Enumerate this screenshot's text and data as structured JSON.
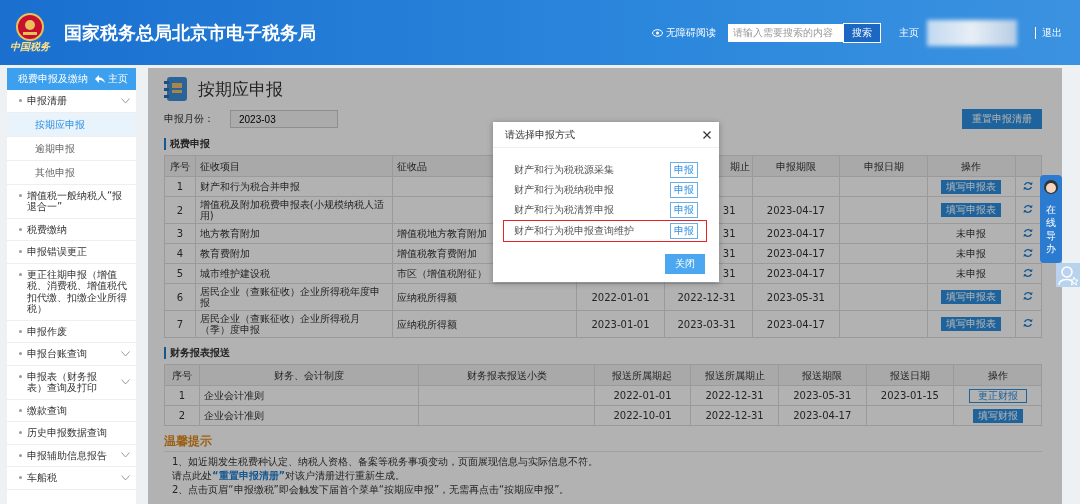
{
  "header": {
    "site_title": "国家税务总局北京市电子税务局",
    "logo_caption": "中国税务",
    "accessibility_label": "无障碍阅读",
    "search": {
      "placeholder": "请输入需要搜索的内容",
      "button": "搜索"
    },
    "home_link": "主页",
    "logout_link": "退出"
  },
  "sidebar": {
    "title": "税费申报及缴纳",
    "home": "主页",
    "items": [
      {
        "label": "申报清册",
        "kind": "group",
        "children": [
          {
            "label": "按期应申报",
            "selected": true
          },
          {
            "label": "逾期申报",
            "selected": false
          },
          {
            "label": "其他申报",
            "selected": false
          }
        ]
      },
      {
        "label": "增值税一般纳税人“报退合一”",
        "kind": "link"
      },
      {
        "label": "税费缴纳",
        "kind": "link"
      },
      {
        "label": "申报错误更正",
        "kind": "link"
      },
      {
        "label": "更正往期申报（增值税、消费税、增值税代扣代缴、扣缴企业所得税）",
        "kind": "link"
      },
      {
        "label": "申报作废",
        "kind": "link"
      },
      {
        "label": "申报台账查询",
        "kind": "group"
      },
      {
        "label": "申报表（财务报表）查询及打印",
        "kind": "group"
      },
      {
        "label": "缴款查询",
        "kind": "link"
      },
      {
        "label": "历史申报数据查询",
        "kind": "link"
      },
      {
        "label": "申报辅助信息报告",
        "kind": "group"
      },
      {
        "label": "车船税",
        "kind": "group"
      }
    ]
  },
  "page": {
    "title": "按期应申报",
    "month_label": "申报月份：",
    "month_value": "2023-03",
    "reset_button": "重置申报清册"
  },
  "tax_section": {
    "title": "税费申报",
    "columns": [
      "序号",
      "征收项目",
      "征收品",
      "",
      "期止",
      "申报期限",
      "申报日期",
      "操作"
    ],
    "rows": [
      {
        "cells": [
          "1",
          "财产和行为税合并申报",
          "",
          "",
          "",
          "",
          ""
        ],
        "action": {
          "kind": "button",
          "label": "填写申报表"
        }
      },
      {
        "cells": [
          "2",
          "增值税及附加税费申报表(小规模纳税人适用)",
          "",
          "",
          "31",
          "2023-04-17",
          ""
        ],
        "action": {
          "kind": "button",
          "label": "填写申报表"
        }
      },
      {
        "cells": [
          "3",
          "地方教育附加",
          "增值税地方教育附加",
          "",
          "31",
          "2023-04-17",
          ""
        ],
        "action": {
          "kind": "text",
          "label": "未申报"
        }
      },
      {
        "cells": [
          "4",
          "教育费附加",
          "增值税教育费附加",
          "",
          "31",
          "2023-04-17",
          ""
        ],
        "action": {
          "kind": "text",
          "label": "未申报"
        }
      },
      {
        "cells": [
          "5",
          "城市维护建设税",
          "市区（增值税附征）",
          "",
          "31",
          "2023-04-17",
          ""
        ],
        "action": {
          "kind": "text",
          "label": "未申报"
        }
      },
      {
        "cells": [
          "6",
          "居民企业（查账征收）企业所得税年度申报",
          "应纳税所得额",
          "2022-01-01",
          "2022-12-31",
          "2023-05-31",
          ""
        ],
        "action": {
          "kind": "button",
          "label": "填写申报表"
        }
      },
      {
        "cells": [
          "7",
          "居民企业（查账征收）企业所得税月（季）度申报",
          "应纳税所得额",
          "2023-01-01",
          "2023-03-31",
          "2023-04-17",
          ""
        ],
        "action": {
          "kind": "button",
          "label": "填写申报表"
        }
      }
    ]
  },
  "finance_section": {
    "title": "财务报表报送",
    "columns": [
      "序号",
      "财务、会计制度",
      "财务报表报送小类",
      "报送所属期起",
      "报送所属期止",
      "报送期限",
      "报送日期",
      "操作"
    ],
    "rows": [
      {
        "cells": [
          "1",
          "企业会计准则",
          "",
          "2022-01-01",
          "2022-12-31",
          "2023-05-31",
          "2023-01-15"
        ],
        "action": {
          "kind": "outline",
          "label": "更正财报"
        }
      },
      {
        "cells": [
          "2",
          "企业会计准则",
          "",
          "2022-10-01",
          "2022-12-31",
          "2023-04-17",
          ""
        ],
        "action": {
          "kind": "button",
          "label": "填写财报"
        }
      }
    ]
  },
  "tips": {
    "title": "温馨提示",
    "lines": [
      {
        "before": "1、如近期发生税费种认定、纳税人资格、备案等税务事项变动，页面展现信息与实际信息不符。"
      },
      {
        "before": "请点此处",
        "link": "“重置申报清册”",
        "after": "对该户清册进行重新生成。"
      },
      {
        "before": "2、点击页眉“申报缴税”即会触发下届首个菜单“按期应申报”，无需再点击“按期应申报”。"
      }
    ]
  },
  "modal": {
    "title": "请选择申报方式",
    "options": [
      {
        "label": "财产和行为税税源采集",
        "button": "申报",
        "highlighted": false
      },
      {
        "label": "财产和行为税纳税申报",
        "button": "申报",
        "highlighted": false
      },
      {
        "label": "财产和行为税清算申报",
        "button": "申报",
        "highlighted": false
      },
      {
        "label": "财产和行为税申报查询维护",
        "button": "申报",
        "highlighted": true
      }
    ],
    "close_button": "关闭"
  },
  "assistant": {
    "label": "在线导办"
  }
}
